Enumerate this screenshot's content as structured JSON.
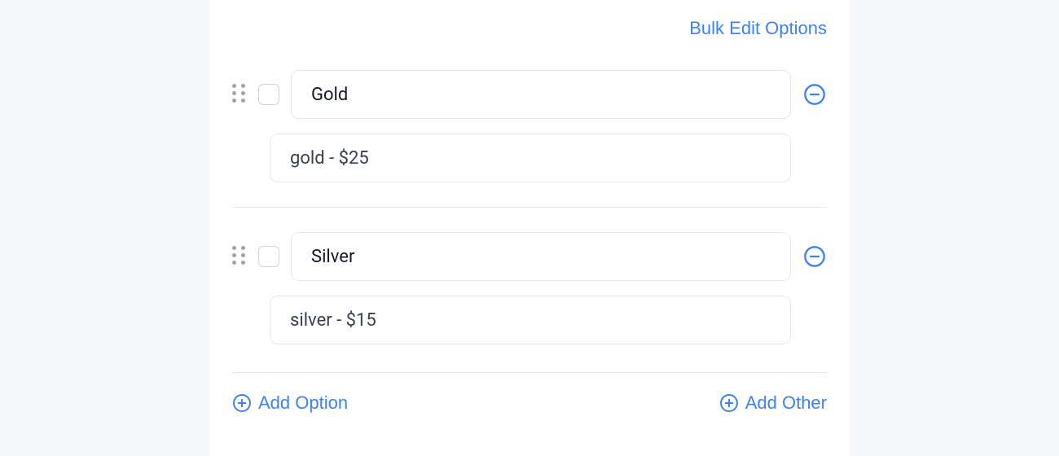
{
  "header": {
    "bulk_edit_label": "Bulk Edit Options"
  },
  "options": [
    {
      "name": "Gold",
      "detail": "gold - $25"
    },
    {
      "name": "Silver",
      "detail": "silver - $15"
    }
  ],
  "footer": {
    "add_option_label": "Add Option",
    "add_other_label": "Add Other"
  }
}
